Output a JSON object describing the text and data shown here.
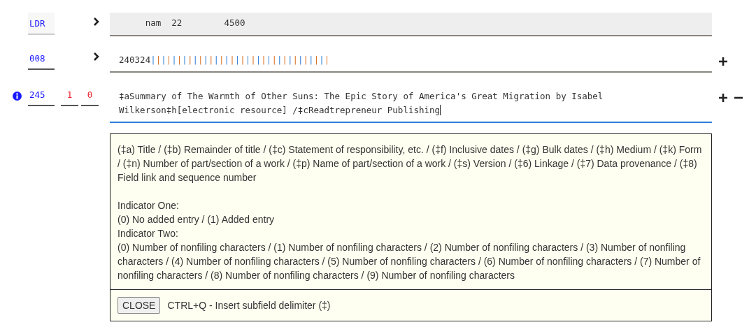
{
  "fields": [
    {
      "kind": "leader",
      "tag": "LDR",
      "value": "     nam  22        4500",
      "expandable": true,
      "focused": false,
      "info": false,
      "can_add": false,
      "can_remove": false
    },
    {
      "kind": "control",
      "tag": "008",
      "value": "240324||||||||||||||||||||||||||||||||||",
      "expandable": true,
      "focused": false,
      "info": false,
      "can_add": true,
      "can_remove": false
    },
    {
      "kind": "data",
      "tag": "245",
      "indicators": [
        "1",
        "0"
      ],
      "value": "‡aSummary of The Warmth of Other Suns: The Epic Story of America's Great Migration by Isabel Wilkerson‡h[electronic resource] /‡cReadtrepreneur Publishing",
      "expandable": false,
      "focused": true,
      "info": true,
      "can_add": true,
      "can_remove": true
    }
  ],
  "help": {
    "subfields": "(‡a) Title / (‡b) Remainder of title / (‡c) Statement of responsibility, etc. / (‡f) Inclusive dates / (‡g) Bulk dates / (‡h) Medium / (‡k) Form / (‡n) Number of part/section of a work / (‡p) Name of part/section of a work / (‡s) Version / (‡6) Linkage / (‡7) Data provenance / (‡8) Field link and sequence number",
    "indicators": [
      {
        "label": "Indicator One:",
        "values": "(0) No added entry / (1) Added entry"
      },
      {
        "label": "Indicator Two:",
        "values": "(0) Number of nonfiling characters / (1) Number of nonfiling characters / (2) Number of nonfiling characters / (3) Number of nonfiling characters / (4) Number of nonfiling characters / (5) Number of nonfiling characters / (6) Number of nonfiling characters / (7) Number of nonfiling characters / (8) Number of nonfiling characters / (9) Number of nonfiling characters"
      }
    ],
    "close_button": "CLOSE",
    "shortcut": "CTRL+Q - Insert subfield delimiter (‡)"
  }
}
